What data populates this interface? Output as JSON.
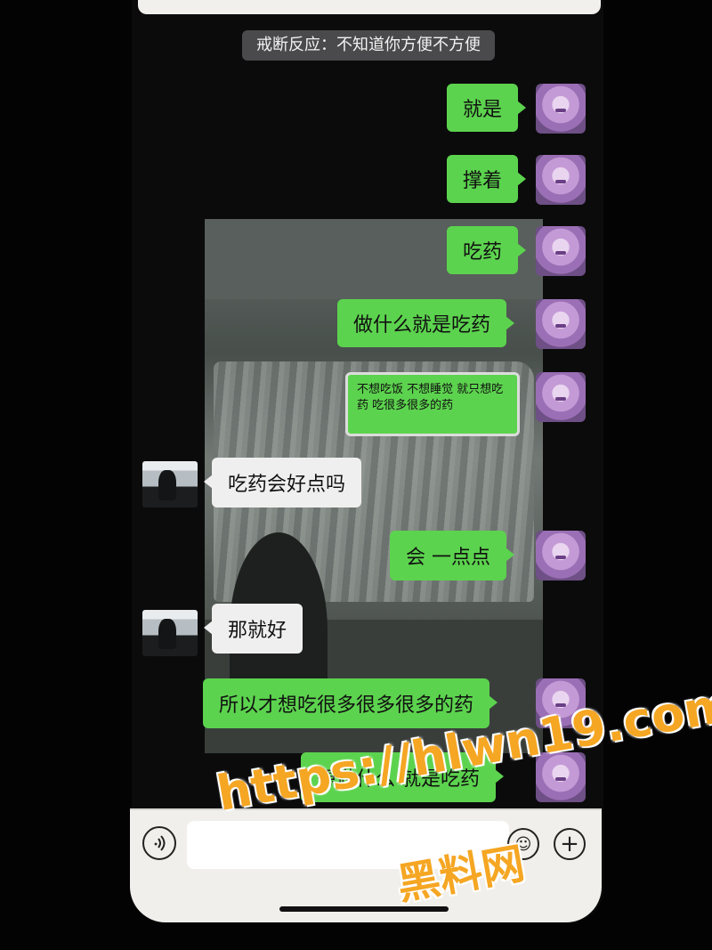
{
  "system_notice": "戒断反应：不知道你方便不方便",
  "messages": [
    {
      "side": "out",
      "text": "就是"
    },
    {
      "side": "out",
      "text": "撑着"
    },
    {
      "side": "out",
      "text": "吃药"
    },
    {
      "side": "out",
      "text": "做什么就是吃药"
    },
    {
      "side": "out",
      "text": "不想吃饭  不想睡觉  就只想吃药  吃很多很多的药"
    },
    {
      "side": "in",
      "text": "吃药会好点吗"
    },
    {
      "side": "out",
      "text": "会  一点点"
    },
    {
      "side": "in",
      "text": "那就好"
    },
    {
      "side": "out",
      "text": "所以才想吃很多很多很多的药"
    },
    {
      "side": "out",
      "text": "想做什么  就是吃药"
    }
  ],
  "input_bar": {
    "voice_icon": "voice-icon",
    "emoji_icon": "emoji-icon",
    "plus_icon": "plus-icon",
    "input_value": ""
  },
  "watermark": {
    "url": "https://hlwn19.com",
    "name": "黑料网"
  },
  "colors": {
    "outgoing_bubble": "#5cd34e",
    "incoming_bubble": "#efefef",
    "watermark": "#f5a623"
  }
}
